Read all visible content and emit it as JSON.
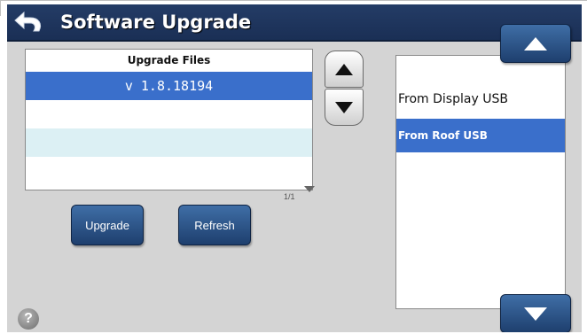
{
  "header": {
    "title": "Software Upgrade",
    "back_icon": "back-arrow-icon"
  },
  "files": {
    "header": "Upgrade Files",
    "rows": [
      "v 1.8.18194",
      "",
      "",
      ""
    ],
    "selected_index": 0,
    "page_indicator": "1/1"
  },
  "buttons": {
    "upgrade": "Upgrade",
    "refresh": "Refresh"
  },
  "sources": {
    "items": [
      "From Display USB",
      "From Roof USB"
    ],
    "selected_index": 1
  },
  "help": {
    "label": "?"
  },
  "colors": {
    "header_bg": "#1f3560",
    "selection": "#3a6fcb",
    "button": "#2a5288",
    "background": "#d4d4d4"
  }
}
